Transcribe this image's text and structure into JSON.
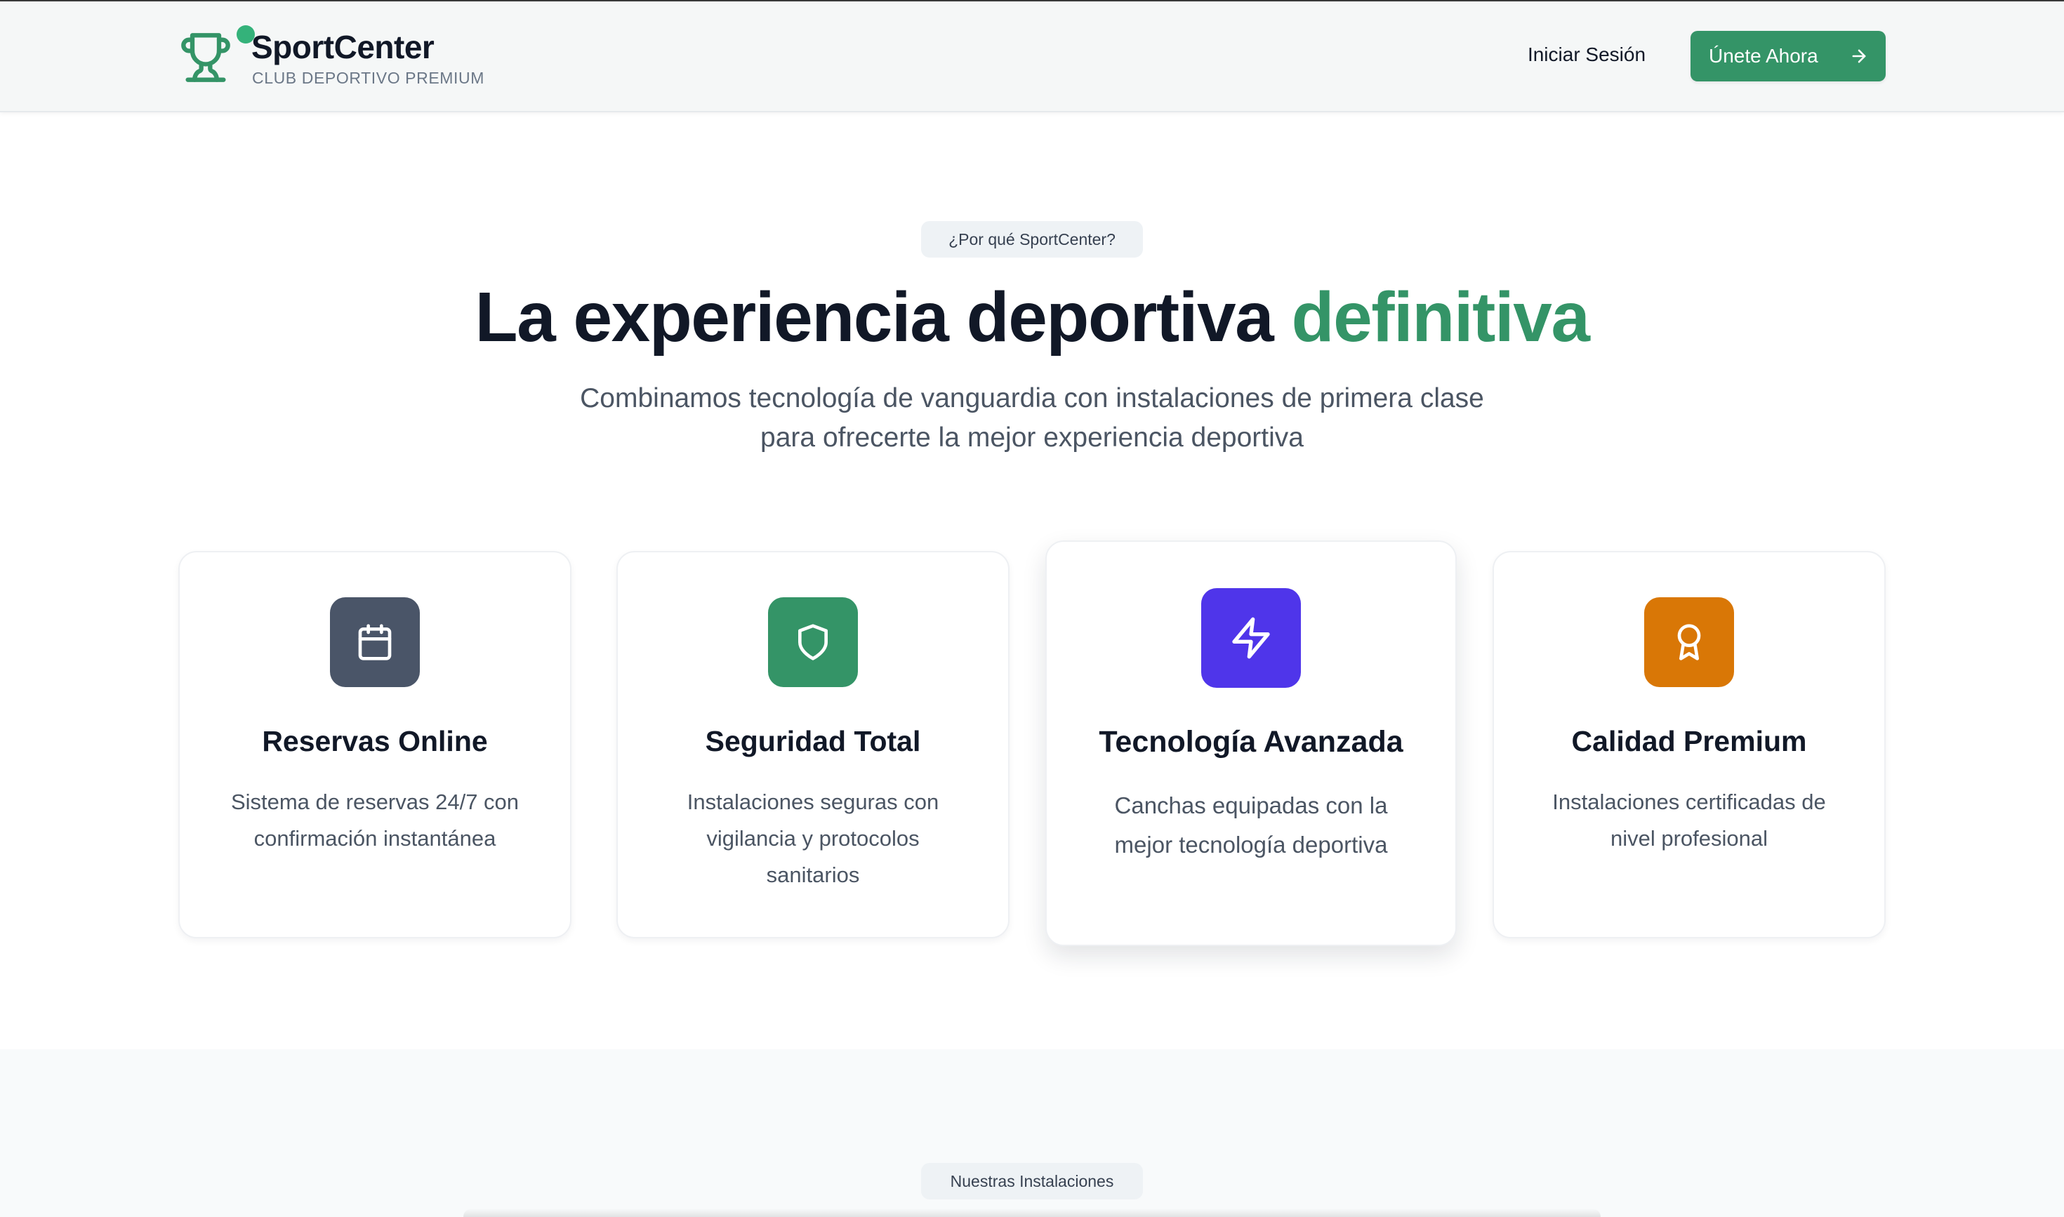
{
  "header": {
    "brand_name": "SportCenter",
    "brand_tagline": "CLUB DEPORTIVO PREMIUM",
    "logo_icon": "trophy-icon",
    "login_label": "Iniciar Sesión",
    "cta_label": "Únete Ahora",
    "cta_icon": "arrow-right-icon"
  },
  "hero": {
    "badge": "¿Por qué SportCenter?",
    "title_main": "La experiencia deportiva",
    "title_accent": "definitiva",
    "subtitle_line1": "Combinamos tecnología de vanguardia con instalaciones de primera clase",
    "subtitle_line2": "para ofrecerte la mejor experiencia deportiva"
  },
  "features": [
    {
      "title": "Reservas Online",
      "desc_lines": [
        "Sistema de reservas 24/7 con",
        "confirmación instantánea"
      ],
      "icon": "calendar-icon",
      "color": "#4a5568"
    },
    {
      "title": "Seguridad Total",
      "desc_lines": [
        "Instalaciones seguras con",
        "vigilancia y protocolos",
        "sanitarios"
      ],
      "icon": "shield-icon",
      "color": "#349467"
    },
    {
      "title": "Tecnología Avanzada",
      "desc_lines": [
        "Canchas equipadas con la",
        "mejor tecnología deportiva"
      ],
      "icon": "lightning-icon",
      "color": "#4f35ea"
    },
    {
      "title": "Calidad Premium",
      "desc_lines": [
        "Instalaciones certificadas de",
        "nivel profesional"
      ],
      "icon": "award-icon",
      "color": "#d97706"
    }
  ],
  "facilities": {
    "badge": "Nuestras Instalaciones"
  },
  "colors": {
    "accent": "#349467",
    "logo_dot": "#34b27a",
    "text_dark": "#111827",
    "text_muted": "#4b5563"
  }
}
